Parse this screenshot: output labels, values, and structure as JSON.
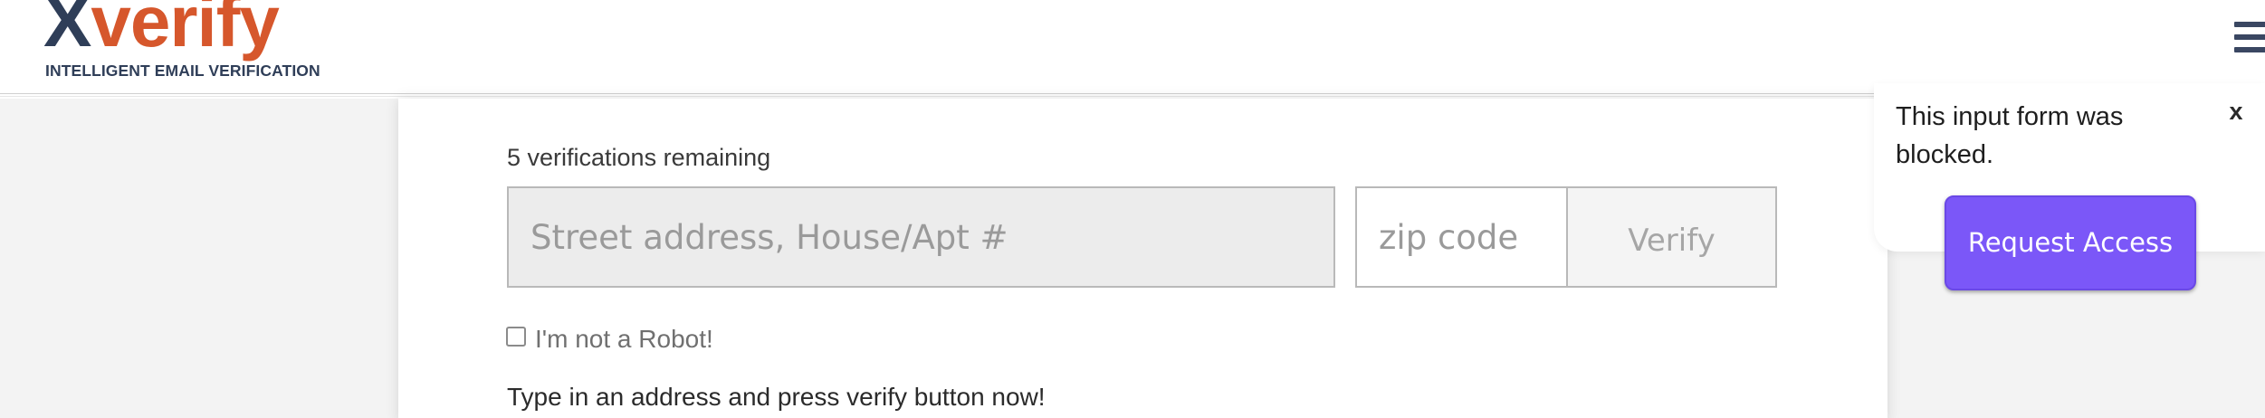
{
  "header": {
    "logo": {
      "first_letter": "X",
      "rest": "verify",
      "tagline": "INTELLIGENT EMAIL VERIFICATION"
    },
    "menu_icon": "hamburger-menu-icon"
  },
  "form": {
    "remaining_text": "5 verifications remaining",
    "street_placeholder": "Street address, House/Apt #",
    "street_value": "",
    "zip_placeholder": "zip code",
    "zip_value": "",
    "verify_label": "Verify",
    "robot_label": "I'm not a Robot!",
    "robot_checked": false,
    "instructions": "Type in an address and press verify button now!"
  },
  "popup": {
    "message": "This input form was blocked.",
    "close_label": "x",
    "request_label": "Request Access"
  },
  "colors": {
    "logo_dark": "#2f3e58",
    "logo_accent": "#d6572c",
    "request_button": "#7b57f8",
    "page_background": "#f3f3f3"
  }
}
